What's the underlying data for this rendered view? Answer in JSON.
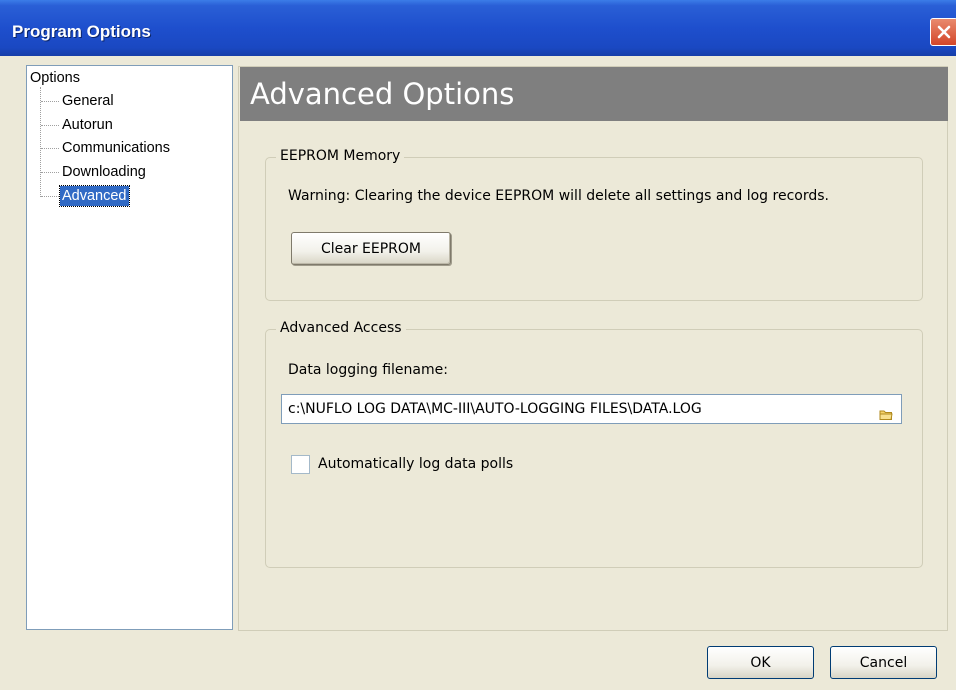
{
  "window": {
    "title": "Program Options"
  },
  "tree": {
    "root": "Options",
    "items": [
      {
        "label": "General"
      },
      {
        "label": "Autorun"
      },
      {
        "label": "Communications"
      },
      {
        "label": "Downloading"
      },
      {
        "label": "Advanced",
        "selected": true
      }
    ]
  },
  "panel": {
    "title": "Advanced Options"
  },
  "eeprom": {
    "group_label": "EEPROM Memory",
    "warning": "Warning: Clearing the device EEPROM will delete all settings and log records.",
    "clear_button": "Clear EEPROM"
  },
  "advanced_access": {
    "group_label": "Advanced Access",
    "filename_label": "Data logging filename:",
    "filename_value": "c:\\NUFLO LOG DATA\\MC-III\\AUTO-LOGGING FILES\\DATA.LOG",
    "auto_log_label": "Automatically log data polls",
    "auto_log_checked": false
  },
  "footer": {
    "ok_label": "OK",
    "cancel_label": "Cancel"
  },
  "icons": {
    "close": "close-icon",
    "folder": "folder-icon"
  },
  "colors": {
    "titlebar": "#1e4fcd",
    "close_button": "#d3462a",
    "header_bar": "#7f7f7f",
    "selection": "#316ac5",
    "dialog_bg": "#ece9d8"
  }
}
